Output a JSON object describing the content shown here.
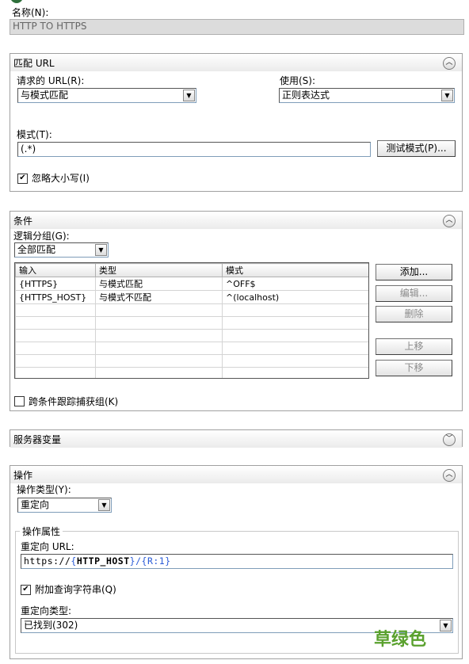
{
  "name_section": {
    "label": "名称(N):",
    "value": "HTTP TO HTTPS"
  },
  "match_url": {
    "title": "匹配 URL",
    "requested_url_label": "请求的 URL(R):",
    "requested_url_value": "与模式匹配",
    "using_label": "使用(S):",
    "using_value": "正则表达式",
    "pattern_label": "模式(T):",
    "pattern_value": "(.*)",
    "test_button": "测试模式(P)...",
    "ignore_case_label": "忽略大小写(I)",
    "ignore_case_checked": true
  },
  "conditions": {
    "title": "条件",
    "logical_group_label": "逻辑分组(G):",
    "logical_group_value": "全部匹配",
    "columns": [
      "输入",
      "类型",
      "模式"
    ],
    "rows": [
      [
        "{HTTPS}",
        "与模式匹配",
        "^OFF$"
      ],
      [
        "{HTTPS_HOST}",
        "与模式不匹配",
        "^(localhost)"
      ]
    ],
    "buttons": {
      "add": "添加...",
      "edit": "编辑...",
      "remove": "删除",
      "move_up": "上移",
      "move_down": "下移"
    },
    "track_captures_label": "跨条件跟踪捕获组(K)",
    "track_captures_checked": false
  },
  "server_variables": {
    "title": "服务器变量"
  },
  "action": {
    "title": "操作",
    "action_type_label": "操作类型(Y):",
    "action_type_value": "重定向",
    "properties_title": "操作属性",
    "redirect_url_label": "重定向 URL:",
    "redirect_url_parts": [
      "https://",
      "{",
      "HTTP_HOST",
      "}/",
      "{",
      "R:1",
      "}"
    ],
    "append_query_label": "附加查询字符串(Q)",
    "append_query_checked": true,
    "redirect_type_label": "重定向类型:",
    "redirect_type_value": "已找到(302)"
  },
  "watermark": {
    "text": "草绿色",
    "color": "#5aa12e"
  },
  "colors": {
    "panel_border": "#a0a0a0",
    "field_border": "#7f9db9",
    "disabled_text": "#8a8a8a"
  }
}
